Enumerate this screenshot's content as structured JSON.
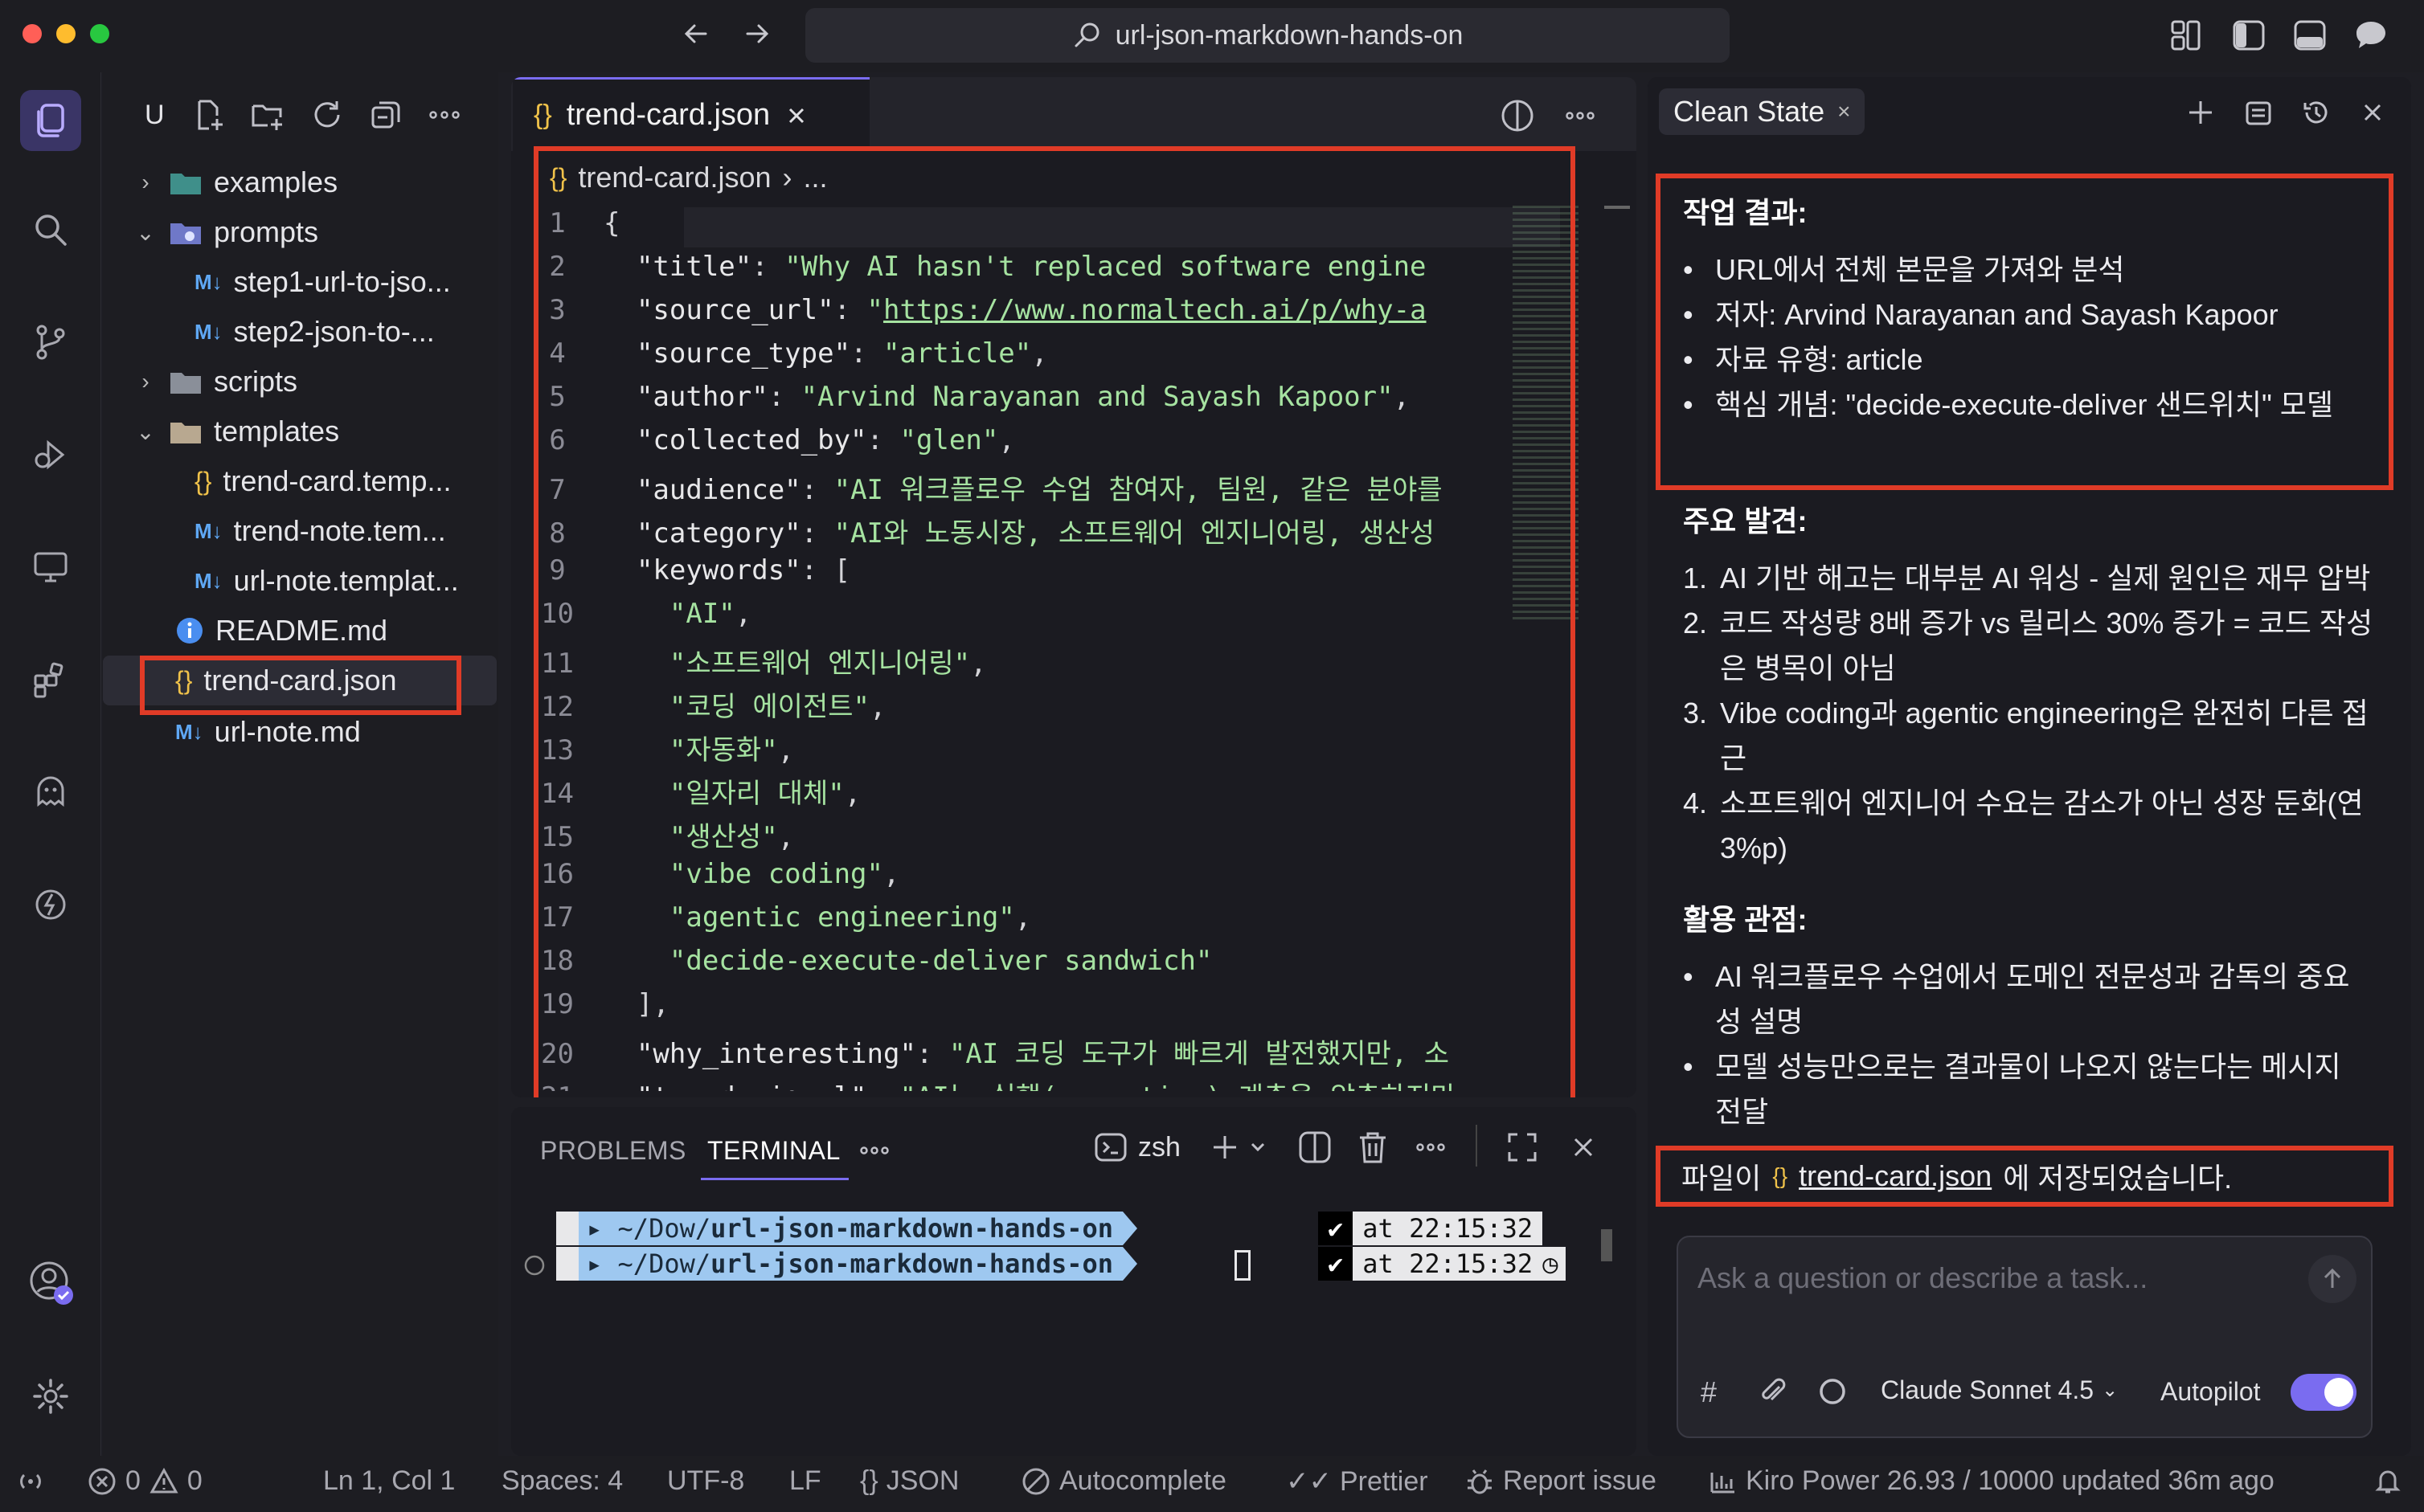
{
  "window": {
    "search_title": "url-json-markdown-hands-on",
    "traffic_colors": [
      "#ff5f57",
      "#febc2e",
      "#28c840"
    ]
  },
  "explorer": {
    "header_label": "U",
    "tree": [
      {
        "label": "examples",
        "kind": "folder",
        "expanded": false
      },
      {
        "label": "prompts",
        "kind": "folder",
        "expanded": true
      },
      {
        "label": "step1-url-to-jso...",
        "kind": "markdown"
      },
      {
        "label": "step2-json-to-...",
        "kind": "markdown"
      },
      {
        "label": "scripts",
        "kind": "folder",
        "expanded": false
      },
      {
        "label": "templates",
        "kind": "folder",
        "expanded": true
      },
      {
        "label": "trend-card.temp...",
        "kind": "json"
      },
      {
        "label": "trend-note.tem...",
        "kind": "markdown"
      },
      {
        "label": "url-note.templat...",
        "kind": "markdown"
      },
      {
        "label": "README.md",
        "kind": "info"
      },
      {
        "label": "trend-card.json",
        "kind": "json",
        "selected": true
      },
      {
        "label": "url-note.md",
        "kind": "markdown"
      }
    ]
  },
  "editor": {
    "tab_label": "trend-card.json",
    "breadcrumb_file": "trend-card.json",
    "breadcrumb_rest": "...",
    "lines": [
      {
        "n": "1",
        "parts": [
          [
            "p",
            "{"
          ]
        ]
      },
      {
        "n": "2",
        "parts": [
          [
            "p",
            "  "
          ],
          [
            "k",
            "\"title\""
          ],
          [
            "p",
            ": "
          ],
          [
            "s",
            "\"Why AI hasn't replaced software engine"
          ]
        ]
      },
      {
        "n": "3",
        "parts": [
          [
            "p",
            "  "
          ],
          [
            "k",
            "\"source_url\""
          ],
          [
            "p",
            ": "
          ],
          [
            "s",
            "\""
          ],
          [
            "u",
            "https://www.normaltech.ai/p/why-a"
          ]
        ]
      },
      {
        "n": "4",
        "parts": [
          [
            "p",
            "  "
          ],
          [
            "k",
            "\"source_type\""
          ],
          [
            "p",
            ": "
          ],
          [
            "s",
            "\"article\""
          ],
          [
            "p",
            ","
          ]
        ]
      },
      {
        "n": "5",
        "parts": [
          [
            "p",
            "  "
          ],
          [
            "k",
            "\"author\""
          ],
          [
            "p",
            ": "
          ],
          [
            "s",
            "\"Arvind Narayanan and Sayash Kapoor\""
          ],
          [
            "p",
            ","
          ]
        ]
      },
      {
        "n": "6",
        "parts": [
          [
            "p",
            "  "
          ],
          [
            "k",
            "\"collected_by\""
          ],
          [
            "p",
            ": "
          ],
          [
            "s",
            "\"glen\""
          ],
          [
            "p",
            ","
          ]
        ]
      },
      {
        "n": "7",
        "parts": [
          [
            "p",
            "  "
          ],
          [
            "k",
            "\"audience\""
          ],
          [
            "p",
            ": "
          ],
          [
            "s",
            "\"AI 워크플로우 수업 참여자, 팀원, 같은 분야를"
          ]
        ]
      },
      {
        "n": "8",
        "parts": [
          [
            "p",
            "  "
          ],
          [
            "k",
            "\"category\""
          ],
          [
            "p",
            ": "
          ],
          [
            "s",
            "\"AI와 노동시장, 소프트웨어 엔지니어링, 생산성 "
          ]
        ]
      },
      {
        "n": "9",
        "parts": [
          [
            "p",
            "  "
          ],
          [
            "k",
            "\"keywords\""
          ],
          [
            "p",
            ": ["
          ]
        ]
      },
      {
        "n": "10",
        "parts": [
          [
            "p",
            "    "
          ],
          [
            "s",
            "\"AI\""
          ],
          [
            "p",
            ","
          ]
        ]
      },
      {
        "n": "11",
        "parts": [
          [
            "p",
            "    "
          ],
          [
            "s",
            "\"소프트웨어 엔지니어링\""
          ],
          [
            "p",
            ","
          ]
        ]
      },
      {
        "n": "12",
        "parts": [
          [
            "p",
            "    "
          ],
          [
            "s",
            "\"코딩 에이전트\""
          ],
          [
            "p",
            ","
          ]
        ]
      },
      {
        "n": "13",
        "parts": [
          [
            "p",
            "    "
          ],
          [
            "s",
            "\"자동화\""
          ],
          [
            "p",
            ","
          ]
        ]
      },
      {
        "n": "14",
        "parts": [
          [
            "p",
            "    "
          ],
          [
            "s",
            "\"일자리 대체\""
          ],
          [
            "p",
            ","
          ]
        ]
      },
      {
        "n": "15",
        "parts": [
          [
            "p",
            "    "
          ],
          [
            "s",
            "\"생산성\""
          ],
          [
            "p",
            ","
          ]
        ]
      },
      {
        "n": "16",
        "parts": [
          [
            "p",
            "    "
          ],
          [
            "s",
            "\"vibe coding\""
          ],
          [
            "p",
            ","
          ]
        ]
      },
      {
        "n": "17",
        "parts": [
          [
            "p",
            "    "
          ],
          [
            "s",
            "\"agentic engineering\""
          ],
          [
            "p",
            ","
          ]
        ]
      },
      {
        "n": "18",
        "parts": [
          [
            "p",
            "    "
          ],
          [
            "s",
            "\"decide-execute-deliver sandwich\""
          ]
        ]
      },
      {
        "n": "19",
        "parts": [
          [
            "p",
            "  ],"
          ]
        ]
      },
      {
        "n": "20",
        "parts": [
          [
            "p",
            "  "
          ],
          [
            "k",
            "\"why_interesting\""
          ],
          [
            "p",
            ": "
          ],
          [
            "s",
            "\"AI 코딩 도구가 빠르게 발전했지만, 소"
          ]
        ]
      },
      {
        "n": "21",
        "parts": [
          [
            "p",
            "  "
          ],
          [
            "k",
            "\"trend_signal\""
          ],
          [
            "p",
            ": "
          ],
          [
            "s",
            "\"AI는 실행(execution) 계층을 압축하지만"
          ]
        ]
      }
    ]
  },
  "panel": {
    "tabs": [
      "PROBLEMS",
      "TERMINAL"
    ],
    "active_tab": "TERMINAL",
    "shell": "zsh",
    "prompts": [
      {
        "path_prefix": "~/Dow/",
        "path_bold": "url-json-markdown-hands-on",
        "check": "✔",
        "time": "at 22:15:32"
      },
      {
        "path_prefix": "~/Dow/",
        "path_bold": "url-json-markdown-hands-on",
        "check": "✔",
        "time": "at 22:15:32"
      }
    ]
  },
  "chat": {
    "tab_label": "Clean State",
    "result_heading": "작업 결과:",
    "result_items": [
      "URL에서 전체 본문을 가져와 분석",
      "저자: Arvind Narayanan and Sayash Kapoor",
      "자료 유형: article",
      "핵심 개념: \"decide-execute-deliver 샌드위치\" 모델"
    ],
    "findings_heading": "주요 발견:",
    "findings": [
      {
        "n": "1.",
        "text": "AI 기반 해고는 대부분 AI 워싱 - 실제 원인은 재무 압박"
      },
      {
        "n": "2.",
        "text": "코드 작성량 8배 증가 vs 릴리스 30% 증가 = 코드 작성은 병목이 아님"
      },
      {
        "n": "3.",
        "text": "Vibe coding과 agentic engineering은 완전히 다른 접근"
      },
      {
        "n": "4.",
        "text": "소프트웨어 엔지니어 수요는 감소가 아닌 성장 둔화(연 3%p)"
      }
    ],
    "usage_heading": "활용 관점:",
    "usage_items": [
      "AI 워크플로우 수업에서 도메인 전문성과 감독의 중요성 설명",
      "모델 성능만으로는 결과물이 나오지 않는다는 메시지 전달"
    ],
    "saved_prefix": "파일이",
    "saved_file": "trend-card.json",
    "saved_suffix": "에 저장되었습니다.",
    "input_placeholder": "Ask a question or describe a task...",
    "model_label": "Claude Sonnet 4.5",
    "autopilot_label": "Autopilot",
    "autopilot_on": true
  },
  "statusbar": {
    "errors": "0",
    "warnings": "0",
    "cursor": "Ln 1, Col 1",
    "spaces": "Spaces: 4",
    "encoding": "UTF-8",
    "eol": "LF",
    "language": "JSON",
    "autocomplete": "Autocomplete",
    "prettier": "Prettier",
    "report": "Report issue",
    "power": "Kiro Power 26.93 / 10000 updated 36m ago"
  },
  "colors": {
    "accent": "#7a6cf0",
    "highlight_box": "#e03b27",
    "string": "#a6e3a1",
    "terminal_path_bg": "#9ec8f0"
  }
}
